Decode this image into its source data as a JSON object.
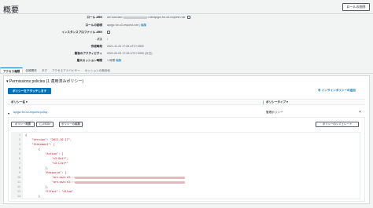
{
  "header": {
    "title": "概要",
    "delete_button": "ロールの削除"
  },
  "summary": {
    "role_arn_label": "ロール ARN",
    "role_arn_prefix": "arn:aws:iam::",
    "role_arn_suffix": ":role/apigw-for-s3-request-role",
    "role_desc_label": "ロールの説明",
    "role_desc_value": "apigw-for-s3-request-role | ",
    "edit_link": "編集",
    "instance_profile_label": "インスタンスプロファイル ARN",
    "path_label": "パス",
    "path_value": "/",
    "created_label": "作成時刻",
    "created_value": "2021-11-24 17:28 UTC+0900",
    "last_activity_label": "最後のアクティビティ",
    "last_activity_value": "2022-02-03 17:26 UTC+0900 (今日)",
    "max_session_label": "最大セッション時間",
    "max_session_value": "1 時間 ",
    "max_session_edit": "編集"
  },
  "tabs": [
    "アクセス権限",
    "信頼関係",
    "タグ",
    "アクセスアドバイザー",
    "セッションの無効化"
  ],
  "permissions": {
    "heading": "Permissions policies (1 適用済みポリシー)",
    "attach_button": "ポリシーをアタッチします",
    "inline_link": "インラインポリシーの追加",
    "col_name": "ポリシー名",
    "col_type": "ポリシータイプ",
    "row_name": "apigw-for-s3-request-policy",
    "row_type": "管理ポリシー",
    "btn_summary": "ポリシー概要",
    "btn_json": "{ } JSON",
    "btn_edit": "ポリシーの編集",
    "btn_simulate": "ポリシーのシミュレート"
  },
  "code": {
    "line_numbers": [
      "1",
      "2",
      "3",
      "4",
      "5",
      "6",
      "7",
      "8",
      "9",
      "10",
      "11",
      "12",
      "13",
      "14"
    ],
    "lines": [
      "{",
      "    \"Version\": \"2012-10-17\",",
      "    \"Statement\": [",
      "        {",
      "            \"Action\": [",
      "                \"s3:Get*\",",
      "                \"s3:List*\"",
      "            ],",
      "            \"Resource\": [",
      "                \"arn:aws:s3:::",
      "                \"arn:aws:s3:::",
      "            ],",
      "            \"Effect\": \"Allow\"",
      "        }"
    ]
  }
}
